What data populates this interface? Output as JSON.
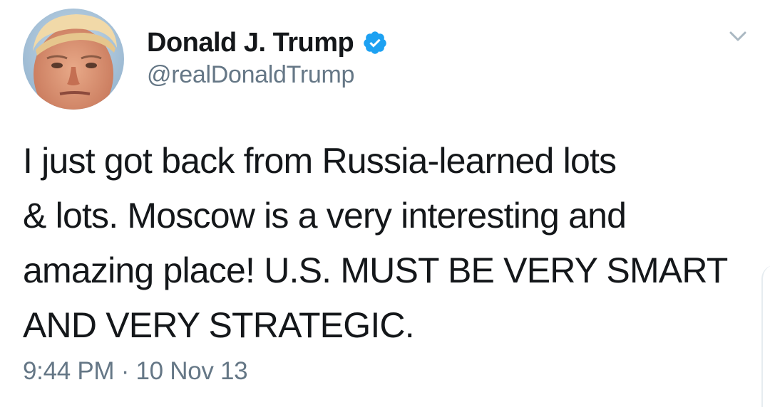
{
  "tweet": {
    "author": {
      "display_name": "Donald J. Trump",
      "handle": "@realDonaldTrump",
      "verified": true
    },
    "text_lines": [
      "I just got back from Russia-learned lots",
      "& lots. Moscow is a very interesting and",
      "amazing place! U.S. MUST BE VERY SMART",
      "AND VERY STRATEGIC."
    ],
    "time": "9:44 PM",
    "separator": "·",
    "date": "10 Nov 13"
  },
  "icons": {
    "verified": "verified-badge-icon",
    "menu": "chevron-down-icon"
  },
  "colors": {
    "text_primary": "#14171a",
    "text_secondary": "#657786",
    "verified_blue": "#1da1f2"
  }
}
